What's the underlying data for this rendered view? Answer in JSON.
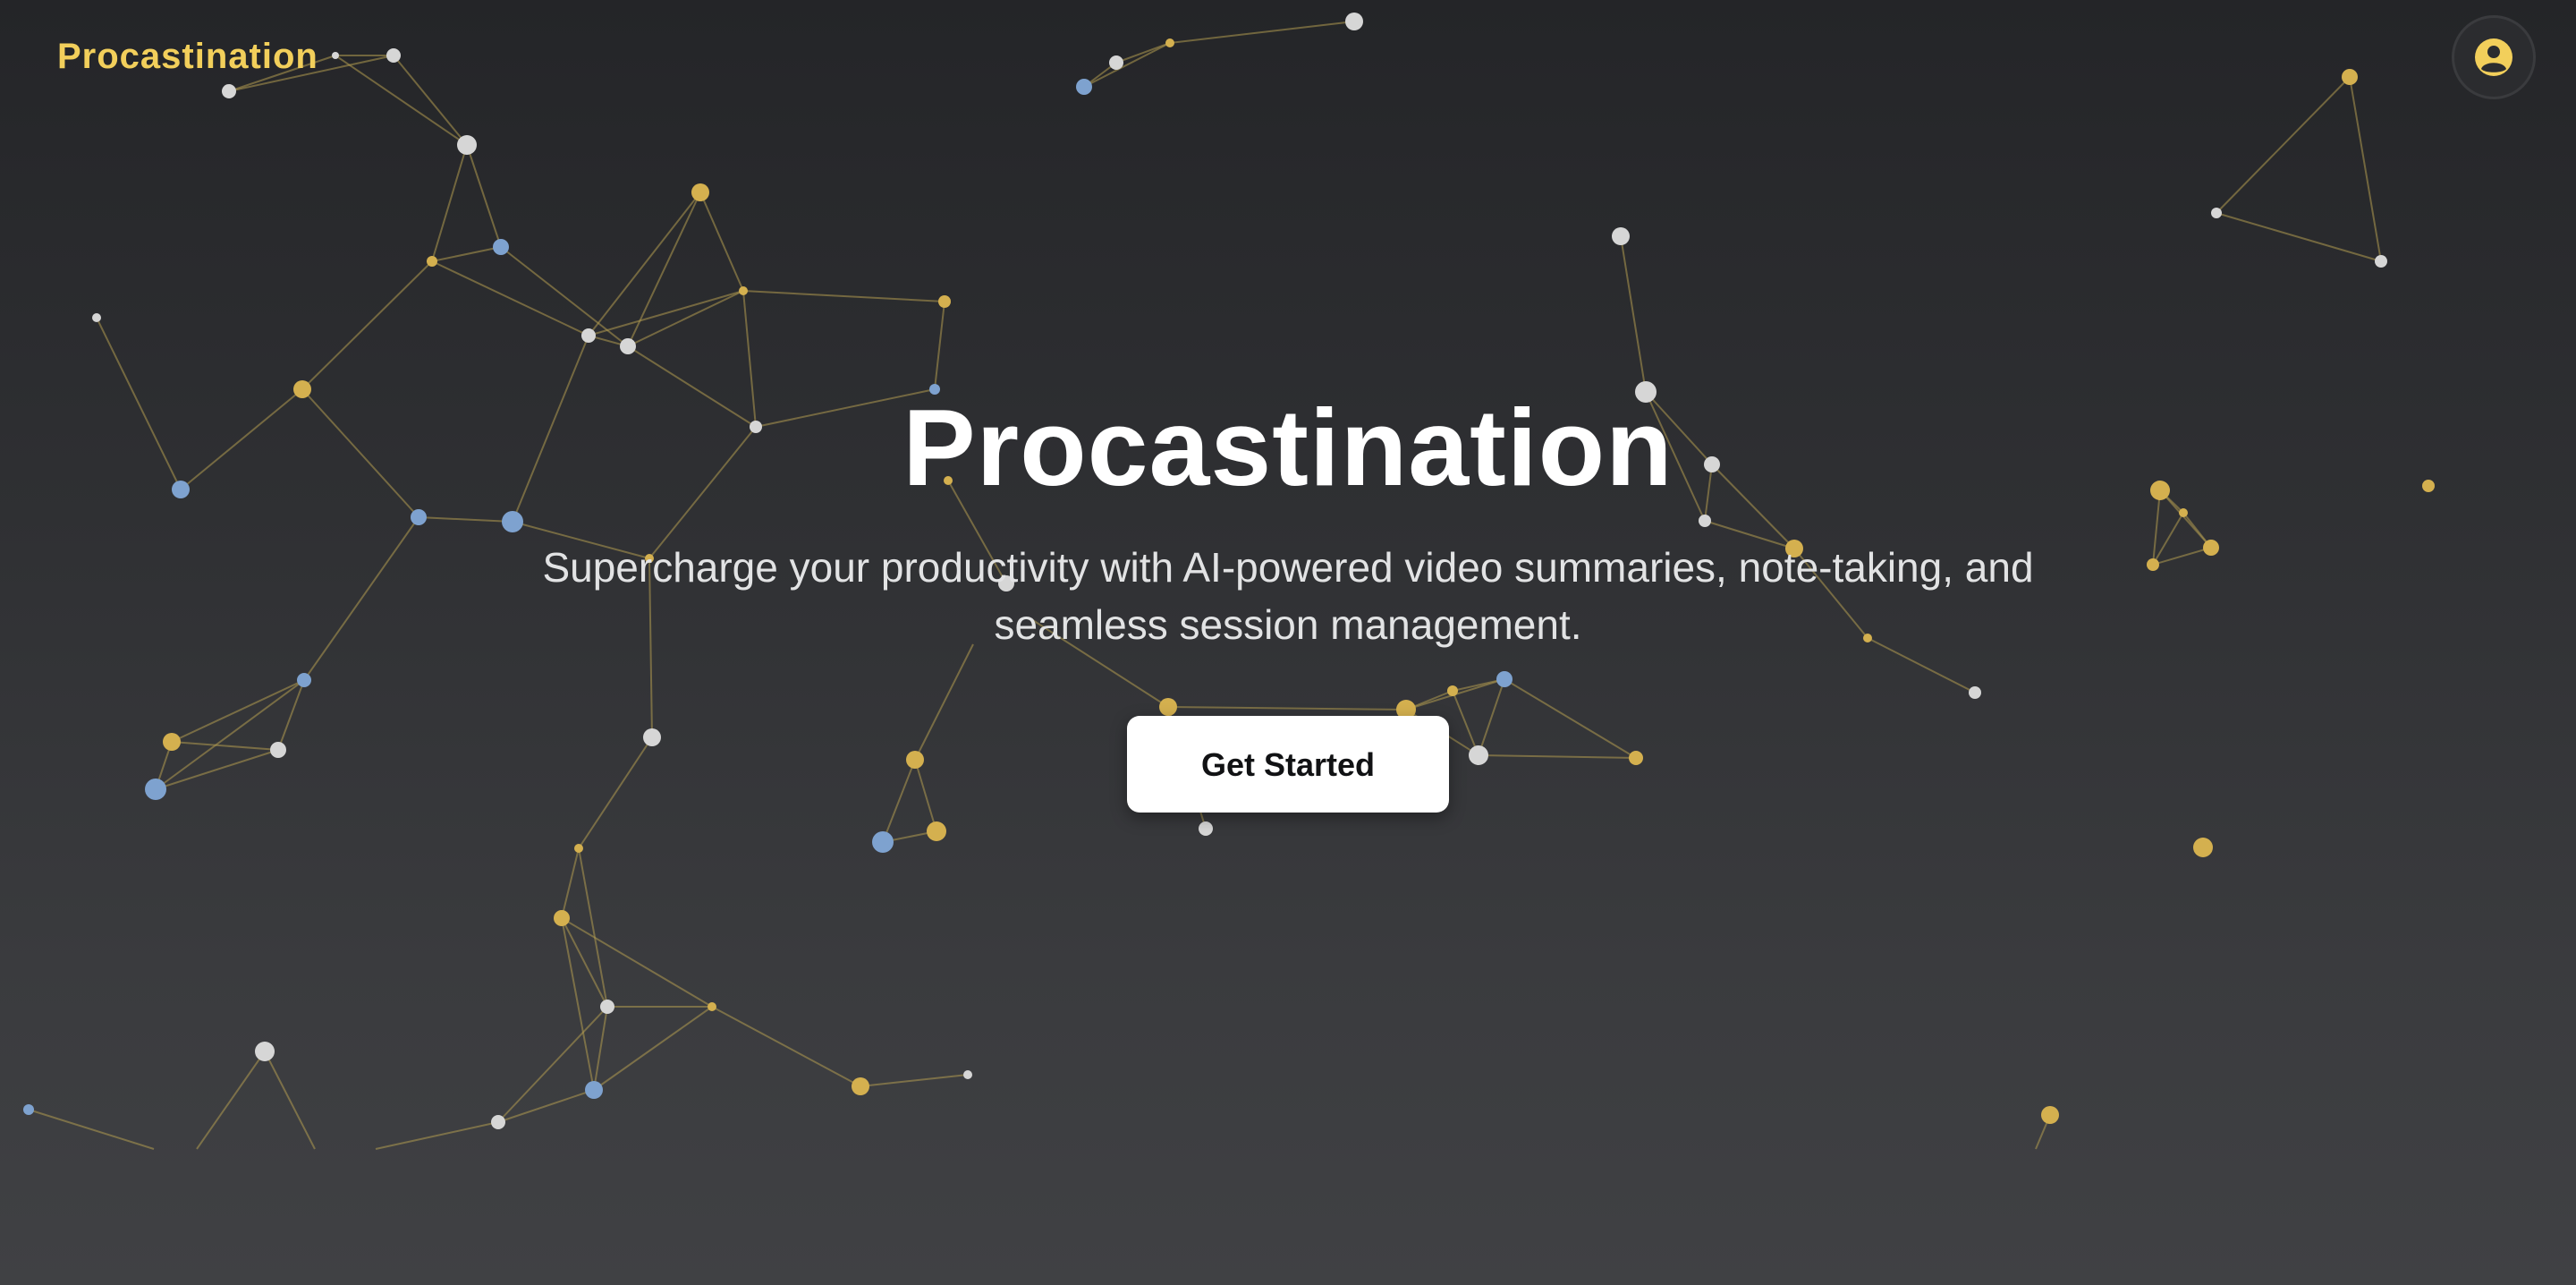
{
  "header": {
    "brand": "Procastination",
    "user_icon": "user-circle-icon"
  },
  "hero": {
    "title": "Procastination",
    "subtitle": "Supercharge your productivity with AI-powered video summaries, note-taking, and seamless session management.",
    "cta_label": "Get Started"
  },
  "theme": {
    "accent": "#f2cf5b",
    "node_gold": "#d4b04f",
    "node_blue": "#7ea2cf",
    "node_white": "#d6d6d6",
    "line": "#a8954f"
  }
}
